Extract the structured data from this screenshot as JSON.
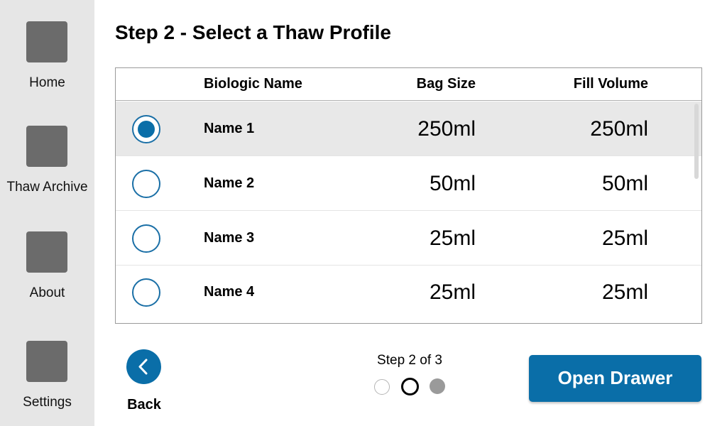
{
  "sidebar": {
    "items": [
      {
        "label": "Home",
        "icon": "home-tile-icon"
      },
      {
        "label": "Thaw Archive",
        "icon": "archive-tile-icon"
      },
      {
        "label": "About",
        "icon": "about-tile-icon"
      },
      {
        "label": "Settings",
        "icon": "settings-tile-icon"
      }
    ]
  },
  "page": {
    "title": "Step 2 - Select a Thaw Profile"
  },
  "table": {
    "columns": [
      "Biologic Name",
      "Bag Size",
      "Fill Volume"
    ],
    "rows": [
      {
        "name": "Name 1",
        "bag_size": "250ml",
        "fill_volume": "250ml",
        "selected": true
      },
      {
        "name": "Name 2",
        "bag_size": "50ml",
        "fill_volume": "50ml",
        "selected": false
      },
      {
        "name": "Name 3",
        "bag_size": "25ml",
        "fill_volume": "25ml",
        "selected": false
      },
      {
        "name": "Name 4",
        "bag_size": "25ml",
        "fill_volume": "25ml",
        "selected": false
      }
    ]
  },
  "footer": {
    "back_label": "Back",
    "step_text": "Step 2 of 3",
    "step_current": 2,
    "step_total": 3,
    "open_drawer_label": "Open Drawer"
  },
  "colors": {
    "accent": "#0a6ea8",
    "sidebar_bg": "#e6e6e6",
    "tile": "#6b6b6b",
    "selected_row": "#e8e8e8"
  }
}
